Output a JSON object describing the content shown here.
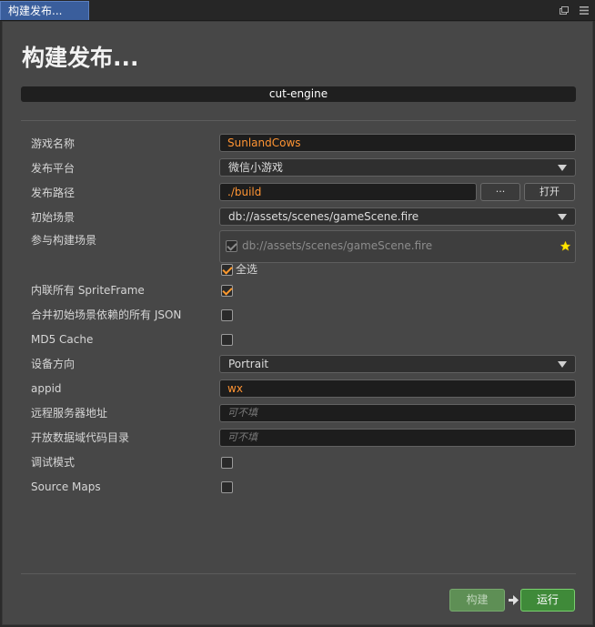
{
  "window": {
    "tab_title": "构建发布...",
    "icons": [
      "restore-icon",
      "menu-icon"
    ]
  },
  "panel": {
    "title": "构建发布...",
    "project_name": "cut-engine"
  },
  "form": {
    "game_name": {
      "label": "游戏名称",
      "value": "SunlandCows"
    },
    "platform": {
      "label": "发布平台",
      "value": "微信小游戏"
    },
    "build_path": {
      "label": "发布路径",
      "value": "./build",
      "browse_label": "···",
      "open_label": "打开"
    },
    "start_scene": {
      "label": "初始场景",
      "value": "db://assets/scenes/gameScene.fire"
    },
    "included_scenes": {
      "label": "参与构建场景",
      "scenes": [
        {
          "path": "db://assets/scenes/gameScene.fire",
          "checked": true
        }
      ],
      "select_all_label": "全选",
      "select_all_checked": true
    },
    "inline_spriteframe": {
      "label": "内联所有 SpriteFrame",
      "checked": true
    },
    "merge_start_scene_json": {
      "label": "合并初始场景依赖的所有 JSON",
      "checked": false
    },
    "md5_cache": {
      "label": "MD5 Cache",
      "checked": false
    },
    "orientation": {
      "label": "设备方向",
      "value": "Portrait"
    },
    "appid": {
      "label": "appid",
      "value": "wx"
    },
    "remote_server": {
      "label": "远程服务器地址",
      "placeholder": "可不填"
    },
    "open_data_dir": {
      "label": "开放数据域代码目录",
      "placeholder": "可不填"
    },
    "debug_mode": {
      "label": "调试模式",
      "checked": false
    },
    "source_maps": {
      "label": "Source Maps",
      "checked": false
    }
  },
  "footer": {
    "build_label": "构建",
    "run_label": "运行"
  },
  "colors": {
    "accent_orange": "#ff9433",
    "run_green": "#3f8a39",
    "build_green_disabled": "#5e8f55",
    "tab_blue": "#3a5e9c"
  }
}
